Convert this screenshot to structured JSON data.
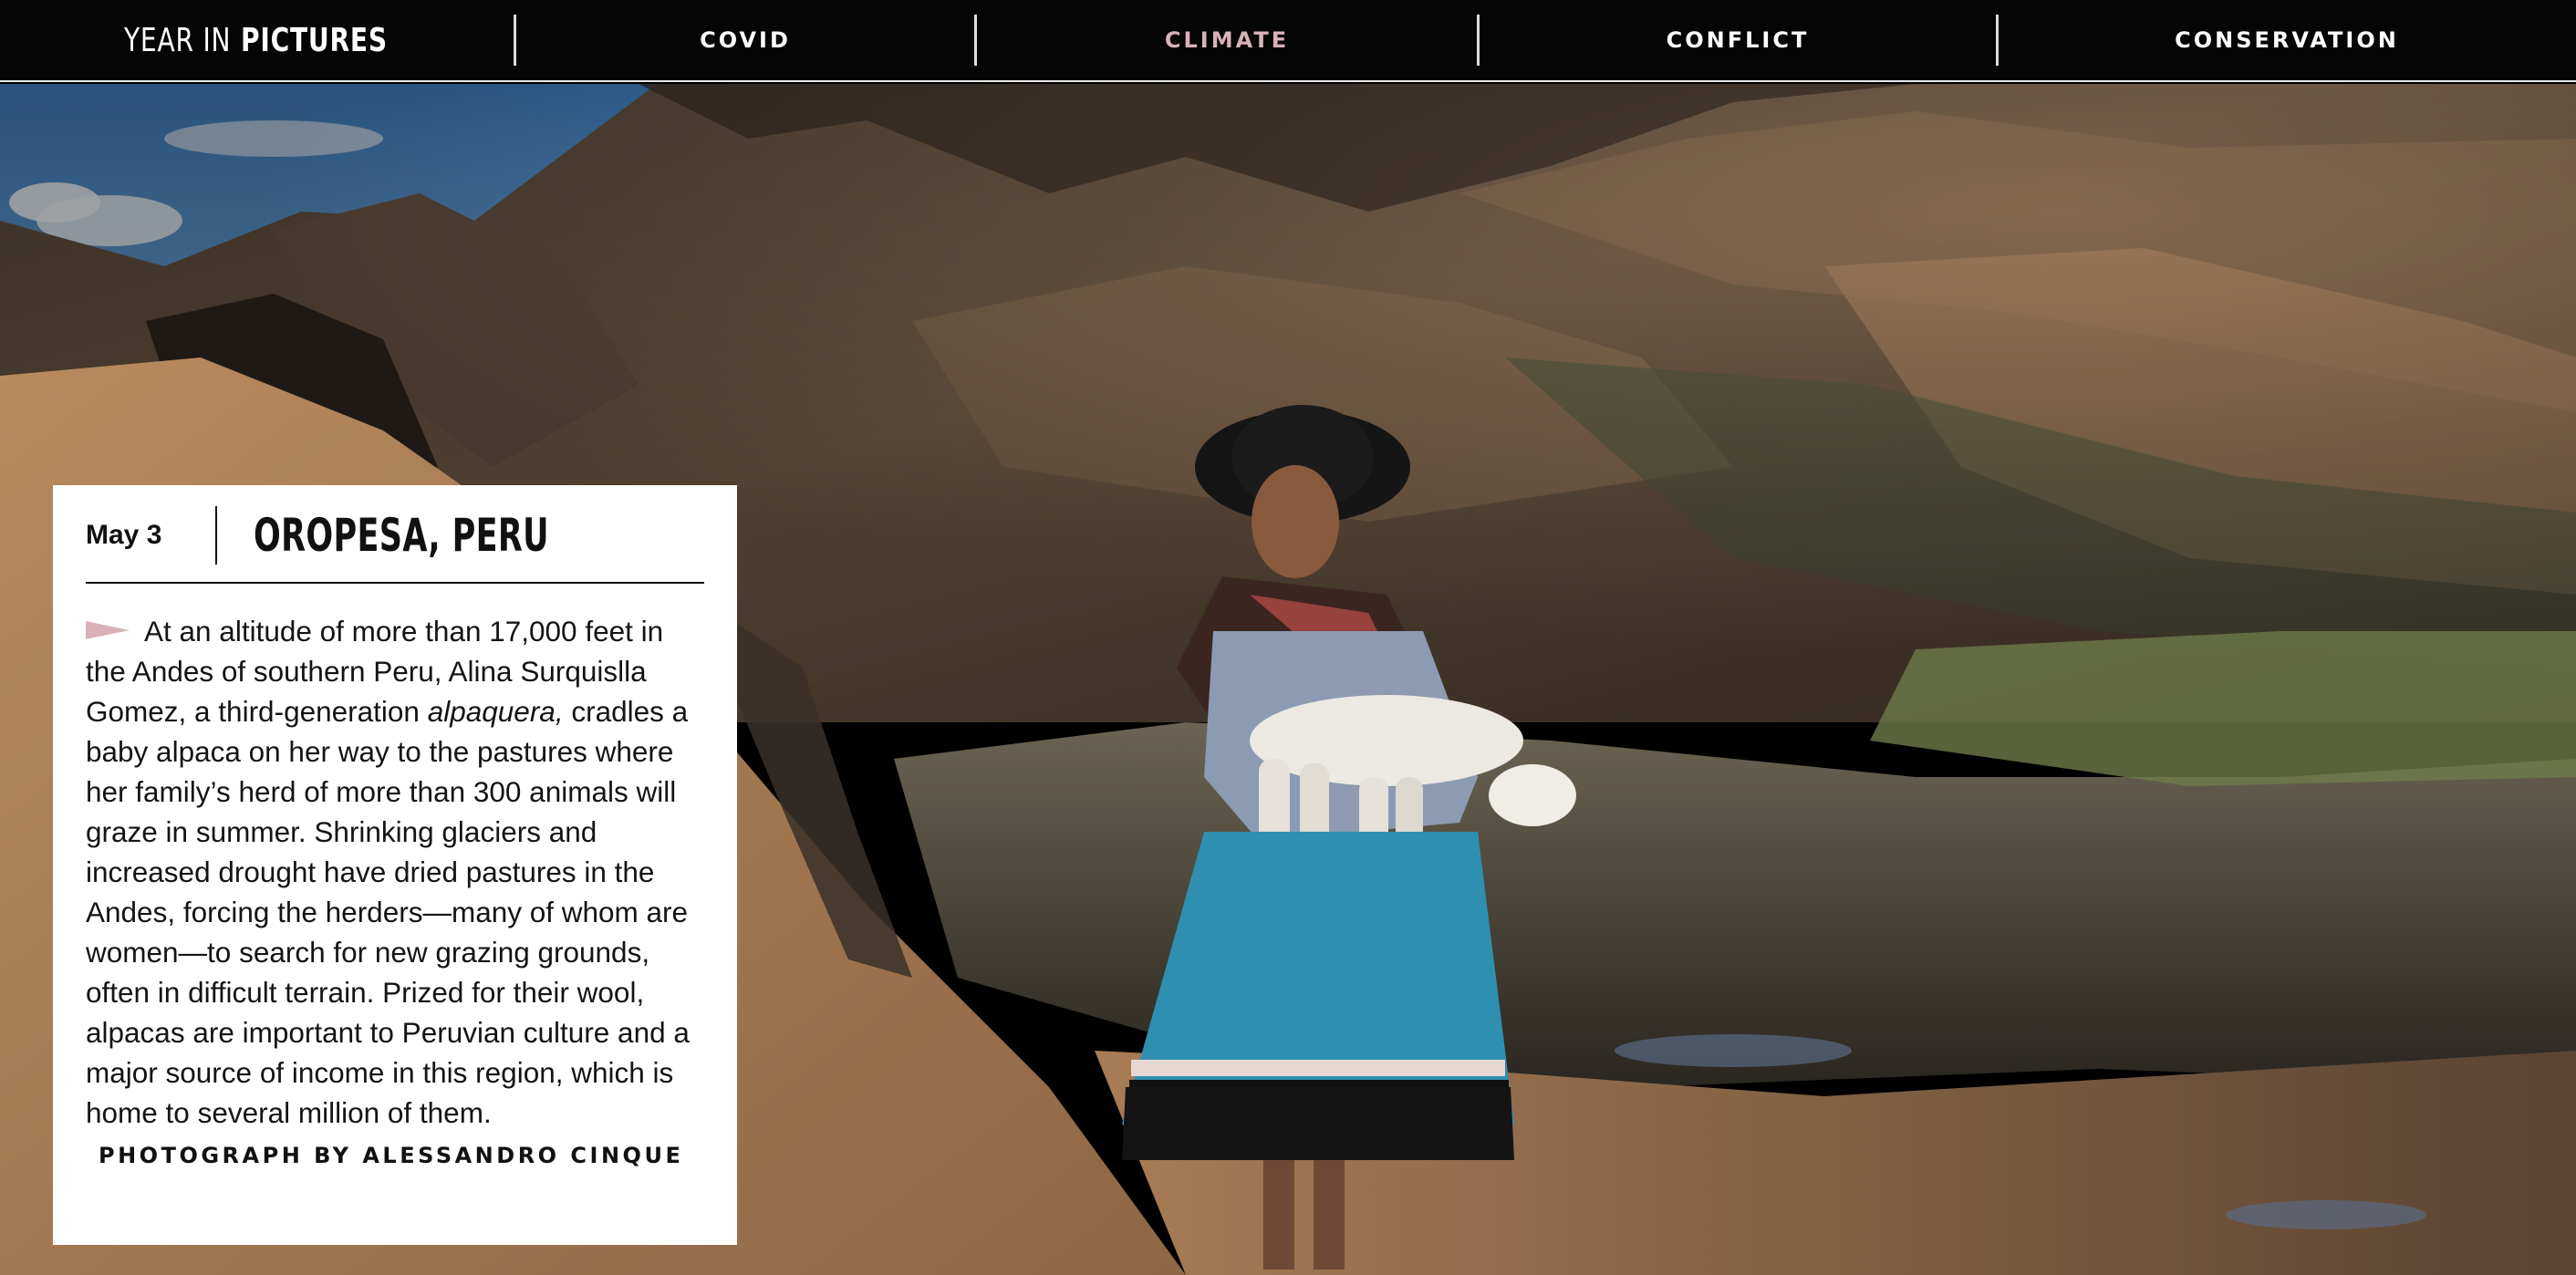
{
  "header": {
    "brand_light": "YEAR IN",
    "brand_bold": "PICTURES",
    "nav": [
      {
        "label": "COVID",
        "active": false
      },
      {
        "label": "CLIMATE",
        "active": true
      },
      {
        "label": "CONFLICT",
        "active": false
      },
      {
        "label": "CONSERVATION",
        "active": false
      }
    ]
  },
  "colors": {
    "nav_background": "#050505",
    "nav_active": "#d9b2b9",
    "accent_pointer": "#d9b2b9",
    "card_background": "#ffffff"
  },
  "photo": {
    "icon": "photo-landscape"
  },
  "caption": {
    "date": "May 3",
    "location": "OROPESA, PERU",
    "text_before_italic": "At an altitude of more than 17,000 feet in the Andes of southern Peru, Alina Surquislla Gomez, a third-generation ",
    "italic": "alpaquera,",
    "text_after_italic": " cradles a baby alpaca on her way to the pastures where her family’s herd of more than 300 animals will graze in summer. Shrinking glaciers and increased drought have dried pastures in the Andes, forcing the herders—many of whom are women—to search for new grazing grounds, often in difficult terrain. Prized for their wool, alpacas are important to Peruvian culture and a major source of income in this region, which is home to several million of them.",
    "credit": "PHOTOGRAPH BY ALESSANDRO CINQUE"
  }
}
